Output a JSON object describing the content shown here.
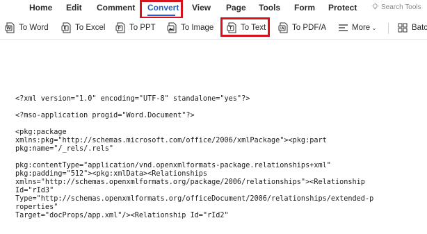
{
  "menu": {
    "items": [
      "Home",
      "Edit",
      "Comment",
      "Convert",
      "View",
      "Page",
      "Tools",
      "Form",
      "Protect"
    ],
    "active": "Convert",
    "search_label": "Search Tools"
  },
  "toolbar": {
    "to_word": "To Word",
    "to_excel": "To Excel",
    "to_ppt": "To PPT",
    "to_image": "To Image",
    "to_text": "To Text",
    "to_pdfa": "To PDF/A",
    "more": "More",
    "batch": "Batc"
  },
  "document": {
    "lines": [
      "<?xml version=\"1.0\" encoding=\"UTF-8\" standalone=\"yes\"?>",
      "",
      "<?mso-application progid=\"Word.Document\"?>",
      "",
      "<pkg:package",
      "xmlns:pkg=\"http://schemas.microsoft.com/office/2006/xmlPackage\"><pkg:part",
      "pkg:name=\"/_rels/.rels\"",
      "",
      "pkg:contentType=\"application/vnd.openxmlformats-package.relationships+xml\"",
      "pkg:padding=\"512\"><pkg:xmlData><Relationships",
      "xmlns=\"http://schemas.openxmlformats.org/package/2006/relationships\"><Relationship",
      "Id=\"rId3\"",
      "Type=\"http://schemas.openxmlformats.org/officeDocument/2006/relationships/extended-p",
      "roperties\"",
      "Target=\"docProps/app.xml\"/><Relationship Id=\"rId2\""
    ]
  },
  "colors": {
    "accent": "#1f5fd1",
    "highlight": "#d6121c"
  }
}
